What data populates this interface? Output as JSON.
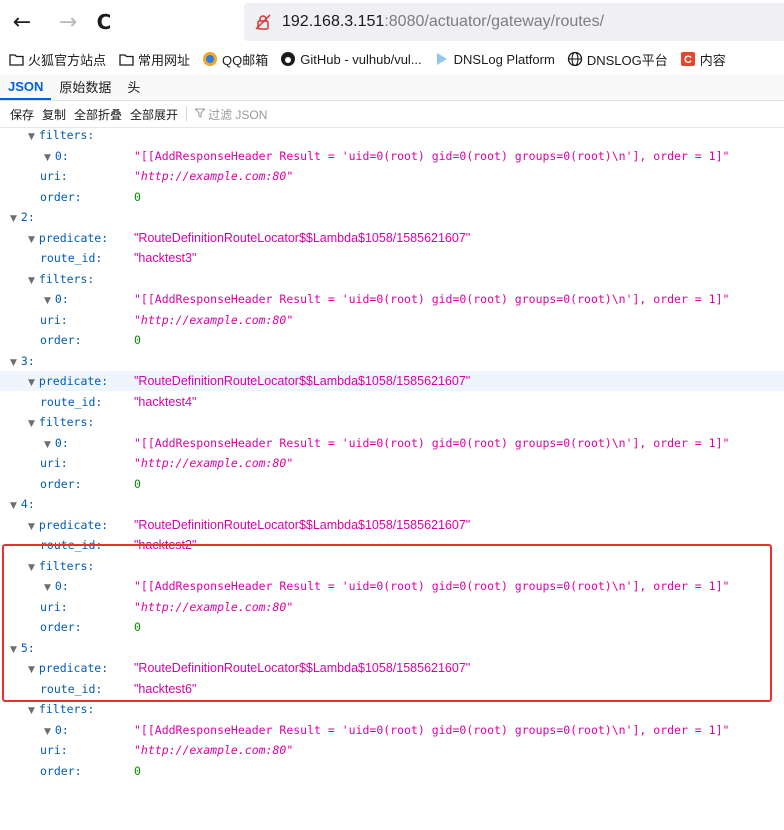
{
  "nav": {
    "back_glyph": "←",
    "forward_glyph": "→",
    "reload_glyph": "C",
    "url_host": "192.168.3.151",
    "url_rest": ":8080/actuator/gateway/routes/"
  },
  "bookmarks": [
    {
      "label": "火狐官方站点",
      "icon": "folder-icon"
    },
    {
      "label": "常用网址",
      "icon": "folder-icon"
    },
    {
      "label": "QQ邮箱",
      "icon": "qq-mail-icon"
    },
    {
      "label": "GitHub - vulhub/vul...",
      "icon": "github-icon"
    },
    {
      "label": "DNSLog Platform",
      "icon": "dnslog-icon"
    },
    {
      "label": "DNSLOG平台",
      "icon": "globe-icon"
    },
    {
      "label": "内容",
      "icon": "c-logo-icon"
    }
  ],
  "tabs": [
    "JSON",
    "原始数据",
    "头"
  ],
  "toolbar": {
    "save": "保存",
    "copy": "复制",
    "collapse_all": "全部折叠",
    "expand_all": "全部展开",
    "filter_placeholder": "过滤 JSON"
  },
  "json_rows": [
    {
      "indent": 1,
      "arrow": true,
      "key": "filters:",
      "val": "",
      "kind": ""
    },
    {
      "indent": 2,
      "arrow": true,
      "key": "0:",
      "val": "\"[[AddResponseHeader Result = 'uid=0(root) gid=0(root) groups=0(root)\\n'], order = 1]\"",
      "kind": "mono"
    },
    {
      "indent": 1,
      "arrow": false,
      "key": "uri:",
      "val": "\"http://example.com:80\"",
      "kind": "url"
    },
    {
      "indent": 1,
      "arrow": false,
      "key": "order:",
      "val": "0",
      "kind": "num"
    },
    {
      "indent": 0,
      "arrow": true,
      "key": "2:",
      "val": "",
      "kind": ""
    },
    {
      "indent": 1,
      "arrow": true,
      "key": "predicate:",
      "val": "\"RouteDefinitionRouteLocator$$Lambda$1058/1585621607\"",
      "kind": "str"
    },
    {
      "indent": 1,
      "arrow": false,
      "key": "route_id:",
      "val": "\"hacktest3\"",
      "kind": "str"
    },
    {
      "indent": 1,
      "arrow": true,
      "key": "filters:",
      "val": "",
      "kind": ""
    },
    {
      "indent": 2,
      "arrow": true,
      "key": "0:",
      "val": "\"[[AddResponseHeader Result = 'uid=0(root) gid=0(root) groups=0(root)\\n'], order = 1]\"",
      "kind": "mono"
    },
    {
      "indent": 1,
      "arrow": false,
      "key": "uri:",
      "val": "\"http://example.com:80\"",
      "kind": "url"
    },
    {
      "indent": 1,
      "arrow": false,
      "key": "order:",
      "val": "0",
      "kind": "num"
    },
    {
      "indent": 0,
      "arrow": true,
      "key": "3:",
      "val": "",
      "kind": ""
    },
    {
      "indent": 1,
      "arrow": true,
      "key": "predicate:",
      "val": "\"RouteDefinitionRouteLocator$$Lambda$1058/1585621607\"",
      "kind": "str",
      "hl": true
    },
    {
      "indent": 1,
      "arrow": false,
      "key": "route_id:",
      "val": "\"hacktest4\"",
      "kind": "str"
    },
    {
      "indent": 1,
      "arrow": true,
      "key": "filters:",
      "val": "",
      "kind": ""
    },
    {
      "indent": 2,
      "arrow": true,
      "key": "0:",
      "val": "\"[[AddResponseHeader Result = 'uid=0(root) gid=0(root) groups=0(root)\\n'], order = 1]\"",
      "kind": "mono"
    },
    {
      "indent": 1,
      "arrow": false,
      "key": "uri:",
      "val": "\"http://example.com:80\"",
      "kind": "url"
    },
    {
      "indent": 1,
      "arrow": false,
      "key": "order:",
      "val": "0",
      "kind": "num"
    },
    {
      "indent": 0,
      "arrow": true,
      "key": "4:",
      "val": "",
      "kind": ""
    },
    {
      "indent": 1,
      "arrow": true,
      "key": "predicate:",
      "val": "\"RouteDefinitionRouteLocator$$Lambda$1058/1585621607\"",
      "kind": "str"
    },
    {
      "indent": 1,
      "arrow": false,
      "key": "route_id:",
      "val": "\"hacktest2\"",
      "kind": "str"
    },
    {
      "indent": 1,
      "arrow": true,
      "key": "filters:",
      "val": "",
      "kind": ""
    },
    {
      "indent": 2,
      "arrow": true,
      "key": "0:",
      "val": "\"[[AddResponseHeader Result = 'uid=0(root) gid=0(root) groups=0(root)\\n'], order = 1]\"",
      "kind": "mono"
    },
    {
      "indent": 1,
      "arrow": false,
      "key": "uri:",
      "val": "\"http://example.com:80\"",
      "kind": "url"
    },
    {
      "indent": 1,
      "arrow": false,
      "key": "order:",
      "val": "0",
      "kind": "num"
    },
    {
      "indent": 0,
      "arrow": true,
      "key": "5:",
      "val": "",
      "kind": ""
    },
    {
      "indent": 1,
      "arrow": true,
      "key": "predicate:",
      "val": "\"RouteDefinitionRouteLocator$$Lambda$1058/1585621607\"",
      "kind": "str"
    },
    {
      "indent": 1,
      "arrow": false,
      "key": "route_id:",
      "val": "\"hacktest6\"",
      "kind": "str"
    },
    {
      "indent": 1,
      "arrow": true,
      "key": "filters:",
      "val": "",
      "kind": ""
    },
    {
      "indent": 2,
      "arrow": true,
      "key": "0:",
      "val": "\"[[AddResponseHeader Result = 'uid=0(root) gid=0(root) groups=0(root)\\n'], order = 1]\"",
      "kind": "mono"
    },
    {
      "indent": 1,
      "arrow": false,
      "key": "uri:",
      "val": "\"http://example.com:80\"",
      "kind": "url"
    },
    {
      "indent": 1,
      "arrow": false,
      "key": "order:",
      "val": "0",
      "kind": "num"
    }
  ],
  "colors": {
    "key": "#005cb5",
    "string": "#dd00a9",
    "number": "#058b00",
    "accent": "#0060df",
    "highlight_border": "#e8312e"
  }
}
